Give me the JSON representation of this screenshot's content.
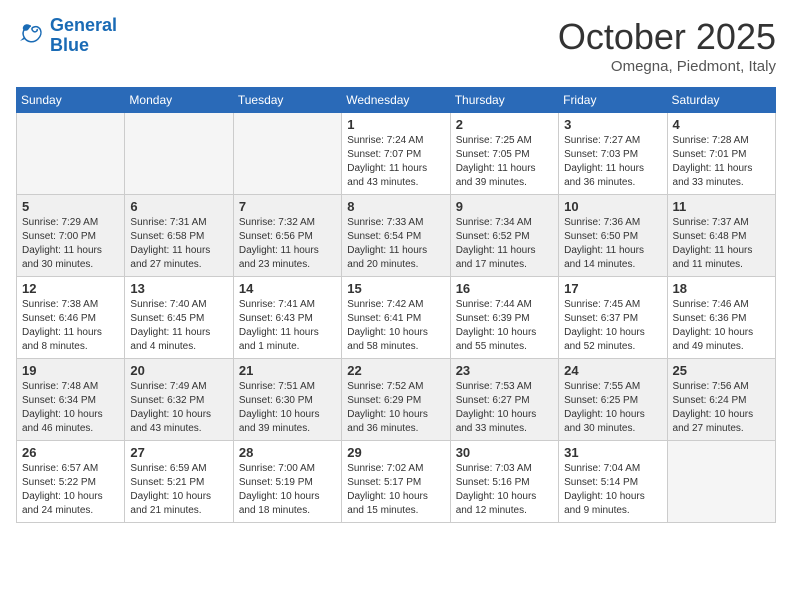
{
  "header": {
    "logo_line1": "General",
    "logo_line2": "Blue",
    "month": "October 2025",
    "location": "Omegna, Piedmont, Italy"
  },
  "days_of_week": [
    "Sunday",
    "Monday",
    "Tuesday",
    "Wednesday",
    "Thursday",
    "Friday",
    "Saturday"
  ],
  "weeks": [
    {
      "shaded": false,
      "days": [
        {
          "num": "",
          "info": ""
        },
        {
          "num": "",
          "info": ""
        },
        {
          "num": "",
          "info": ""
        },
        {
          "num": "1",
          "info": "Sunrise: 7:24 AM\nSunset: 7:07 PM\nDaylight: 11 hours\nand 43 minutes."
        },
        {
          "num": "2",
          "info": "Sunrise: 7:25 AM\nSunset: 7:05 PM\nDaylight: 11 hours\nand 39 minutes."
        },
        {
          "num": "3",
          "info": "Sunrise: 7:27 AM\nSunset: 7:03 PM\nDaylight: 11 hours\nand 36 minutes."
        },
        {
          "num": "4",
          "info": "Sunrise: 7:28 AM\nSunset: 7:01 PM\nDaylight: 11 hours\nand 33 minutes."
        }
      ]
    },
    {
      "shaded": true,
      "days": [
        {
          "num": "5",
          "info": "Sunrise: 7:29 AM\nSunset: 7:00 PM\nDaylight: 11 hours\nand 30 minutes."
        },
        {
          "num": "6",
          "info": "Sunrise: 7:31 AM\nSunset: 6:58 PM\nDaylight: 11 hours\nand 27 minutes."
        },
        {
          "num": "7",
          "info": "Sunrise: 7:32 AM\nSunset: 6:56 PM\nDaylight: 11 hours\nand 23 minutes."
        },
        {
          "num": "8",
          "info": "Sunrise: 7:33 AM\nSunset: 6:54 PM\nDaylight: 11 hours\nand 20 minutes."
        },
        {
          "num": "9",
          "info": "Sunrise: 7:34 AM\nSunset: 6:52 PM\nDaylight: 11 hours\nand 17 minutes."
        },
        {
          "num": "10",
          "info": "Sunrise: 7:36 AM\nSunset: 6:50 PM\nDaylight: 11 hours\nand 14 minutes."
        },
        {
          "num": "11",
          "info": "Sunrise: 7:37 AM\nSunset: 6:48 PM\nDaylight: 11 hours\nand 11 minutes."
        }
      ]
    },
    {
      "shaded": false,
      "days": [
        {
          "num": "12",
          "info": "Sunrise: 7:38 AM\nSunset: 6:46 PM\nDaylight: 11 hours\nand 8 minutes."
        },
        {
          "num": "13",
          "info": "Sunrise: 7:40 AM\nSunset: 6:45 PM\nDaylight: 11 hours\nand 4 minutes."
        },
        {
          "num": "14",
          "info": "Sunrise: 7:41 AM\nSunset: 6:43 PM\nDaylight: 11 hours\nand 1 minute."
        },
        {
          "num": "15",
          "info": "Sunrise: 7:42 AM\nSunset: 6:41 PM\nDaylight: 10 hours\nand 58 minutes."
        },
        {
          "num": "16",
          "info": "Sunrise: 7:44 AM\nSunset: 6:39 PM\nDaylight: 10 hours\nand 55 minutes."
        },
        {
          "num": "17",
          "info": "Sunrise: 7:45 AM\nSunset: 6:37 PM\nDaylight: 10 hours\nand 52 minutes."
        },
        {
          "num": "18",
          "info": "Sunrise: 7:46 AM\nSunset: 6:36 PM\nDaylight: 10 hours\nand 49 minutes."
        }
      ]
    },
    {
      "shaded": true,
      "days": [
        {
          "num": "19",
          "info": "Sunrise: 7:48 AM\nSunset: 6:34 PM\nDaylight: 10 hours\nand 46 minutes."
        },
        {
          "num": "20",
          "info": "Sunrise: 7:49 AM\nSunset: 6:32 PM\nDaylight: 10 hours\nand 43 minutes."
        },
        {
          "num": "21",
          "info": "Sunrise: 7:51 AM\nSunset: 6:30 PM\nDaylight: 10 hours\nand 39 minutes."
        },
        {
          "num": "22",
          "info": "Sunrise: 7:52 AM\nSunset: 6:29 PM\nDaylight: 10 hours\nand 36 minutes."
        },
        {
          "num": "23",
          "info": "Sunrise: 7:53 AM\nSunset: 6:27 PM\nDaylight: 10 hours\nand 33 minutes."
        },
        {
          "num": "24",
          "info": "Sunrise: 7:55 AM\nSunset: 6:25 PM\nDaylight: 10 hours\nand 30 minutes."
        },
        {
          "num": "25",
          "info": "Sunrise: 7:56 AM\nSunset: 6:24 PM\nDaylight: 10 hours\nand 27 minutes."
        }
      ]
    },
    {
      "shaded": false,
      "days": [
        {
          "num": "26",
          "info": "Sunrise: 6:57 AM\nSunset: 5:22 PM\nDaylight: 10 hours\nand 24 minutes."
        },
        {
          "num": "27",
          "info": "Sunrise: 6:59 AM\nSunset: 5:21 PM\nDaylight: 10 hours\nand 21 minutes."
        },
        {
          "num": "28",
          "info": "Sunrise: 7:00 AM\nSunset: 5:19 PM\nDaylight: 10 hours\nand 18 minutes."
        },
        {
          "num": "29",
          "info": "Sunrise: 7:02 AM\nSunset: 5:17 PM\nDaylight: 10 hours\nand 15 minutes."
        },
        {
          "num": "30",
          "info": "Sunrise: 7:03 AM\nSunset: 5:16 PM\nDaylight: 10 hours\nand 12 minutes."
        },
        {
          "num": "31",
          "info": "Sunrise: 7:04 AM\nSunset: 5:14 PM\nDaylight: 10 hours\nand 9 minutes."
        },
        {
          "num": "",
          "info": ""
        }
      ]
    }
  ]
}
